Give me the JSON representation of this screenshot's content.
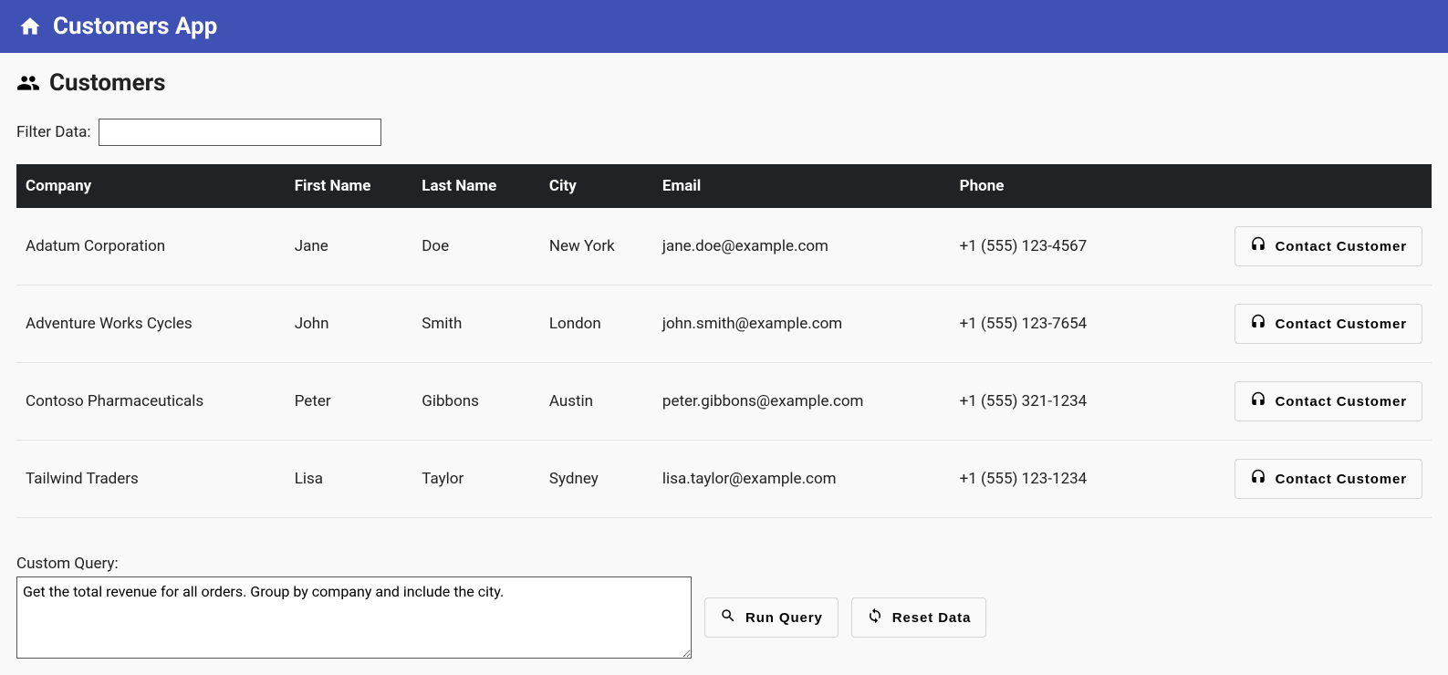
{
  "header": {
    "title": "Customers App"
  },
  "page": {
    "heading": "Customers",
    "filter_label": "Filter Data:",
    "filter_value": ""
  },
  "table": {
    "columns": [
      "Company",
      "First Name",
      "Last Name",
      "City",
      "Email",
      "Phone"
    ],
    "action_label": "Contact Customer",
    "rows": [
      {
        "company": "Adatum Corporation",
        "first_name": "Jane",
        "last_name": "Doe",
        "city": "New York",
        "email": "jane.doe@example.com",
        "phone": "+1 (555) 123-4567"
      },
      {
        "company": "Adventure Works Cycles",
        "first_name": "John",
        "last_name": "Smith",
        "city": "London",
        "email": "john.smith@example.com",
        "phone": "+1 (555) 123-7654"
      },
      {
        "company": "Contoso Pharmaceuticals",
        "first_name": "Peter",
        "last_name": "Gibbons",
        "city": "Austin",
        "email": "peter.gibbons@example.com",
        "phone": "+1 (555) 321-1234"
      },
      {
        "company": "Tailwind Traders",
        "first_name": "Lisa",
        "last_name": "Taylor",
        "city": "Sydney",
        "email": "lisa.taylor@example.com",
        "phone": "+1 (555) 123-1234"
      }
    ]
  },
  "query": {
    "label": "Custom Query:",
    "value": "Get the total revenue for all orders. Group by company and include the city.",
    "run_label": "Run Query",
    "reset_label": "Reset Data"
  }
}
